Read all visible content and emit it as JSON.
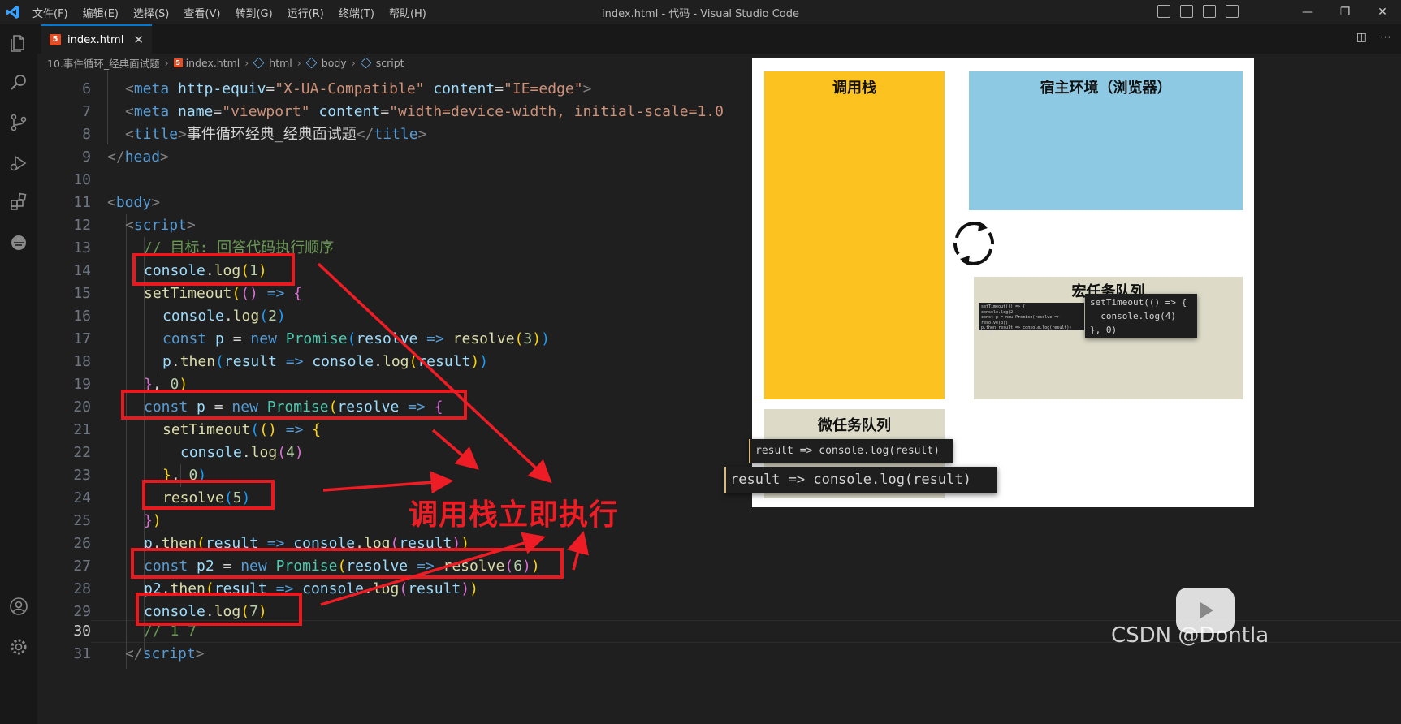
{
  "titlebar": {
    "menu": [
      "文件(F)",
      "编辑(E)",
      "选择(S)",
      "查看(V)",
      "转到(G)",
      "运行(R)",
      "终端(T)",
      "帮助(H)"
    ],
    "window_title": "index.html - 代码 - Visual Studio Code"
  },
  "tab": {
    "name": "index.html",
    "icon": "html5-icon",
    "close": "✕"
  },
  "breadcrumb": {
    "folder": "10.事件循环_经典面试题",
    "file": "index.html",
    "path": [
      "html",
      "body",
      "script"
    ]
  },
  "editor": {
    "line_numbers": [
      "6",
      "7",
      "8",
      "9",
      "10",
      "11",
      "12",
      "13",
      "14",
      "15",
      "16",
      "17",
      "18",
      "19",
      "20",
      "21",
      "22",
      "23",
      "24",
      "25",
      "26",
      "27",
      "28",
      "29",
      "30",
      "31"
    ],
    "current_line": "30",
    "code": {
      "l6_a": "<",
      "l6_b": "meta",
      "l6_c": " http-equiv",
      "l6_d": "=",
      "l6_e": "\"X-UA-Compatible\"",
      "l6_f": " content",
      "l6_g": "=",
      "l6_h": "\"IE=edge\"",
      "l6_i": ">",
      "l7_a": "<",
      "l7_b": "meta",
      "l7_c": " name",
      "l7_d": "=",
      "l7_e": "\"viewport\"",
      "l7_f": " content",
      "l7_g": "=",
      "l7_h": "\"width=device-width, initial-scale=1.0",
      "l8_a": "<",
      "l8_b": "title",
      "l8_c": ">",
      "l8_d": "事件循环经典_经典面试题",
      "l8_e": "</",
      "l8_f": "title",
      "l8_g": ">",
      "l9_a": "</",
      "l9_b": "head",
      "l9_c": ">",
      "l11_a": "<",
      "l11_b": "body",
      "l11_c": ">",
      "l12_a": "<",
      "l12_b": "script",
      "l12_c": ">",
      "l13": "// 目标: 回答代码执行顺序",
      "l14_a": "console",
      "l14_b": ".",
      "l14_c": "log",
      "l14_d": "(",
      "l14_e": "1",
      "l14_f": ")",
      "l15_a": "setTimeout",
      "l15_b": "(",
      "l15_c": "()",
      "l15_d": " => ",
      "l15_e": "{",
      "l16_a": "console",
      "l16_b": ".",
      "l16_c": "log",
      "l16_d": "(",
      "l16_e": "2",
      "l16_f": ")",
      "l17_a": "const",
      "l17_b": " p",
      "l17_c": " = ",
      "l17_d": "new",
      "l17_e": " Promise",
      "l17_f": "(",
      "l17_g": "resolve",
      "l17_h": " => ",
      "l17_i": "resolve",
      "l17_j": "(",
      "l17_k": "3",
      "l17_l": ")",
      "l17_m": ")",
      "l18_a": "p",
      "l18_b": ".",
      "l18_c": "then",
      "l18_d": "(",
      "l18_e": "result",
      "l18_f": " => ",
      "l18_g": "console",
      "l18_h": ".",
      "l18_i": "log",
      "l18_j": "(",
      "l18_k": "result",
      "l18_l": ")",
      "l18_m": ")",
      "l19_a": "}",
      "l19_b": ", ",
      "l19_c": "0",
      "l19_d": ")",
      "l20_a": "const",
      "l20_b": " p",
      "l20_c": " = ",
      "l20_d": "new",
      "l20_e": " Promise",
      "l20_f": "(",
      "l20_g": "resolve",
      "l20_h": " => ",
      "l20_i": "{",
      "l21_a": "setTimeout",
      "l21_b": "(",
      "l21_c": "()",
      "l21_d": " => ",
      "l21_e": "{",
      "l22_a": "console",
      "l22_b": ".",
      "l22_c": "log",
      "l22_d": "(",
      "l22_e": "4",
      "l22_f": ")",
      "l23_a": "}",
      "l23_b": ", ",
      "l23_c": "0",
      "l23_d": ")",
      "l24_a": "resolve",
      "l24_b": "(",
      "l24_c": "5",
      "l24_d": ")",
      "l25_a": "}",
      "l25_b": ")",
      "l26_a": "p",
      "l26_b": ".",
      "l26_c": "then",
      "l26_d": "(",
      "l26_e": "result",
      "l26_f": " => ",
      "l26_g": "console",
      "l26_h": ".",
      "l26_i": "log",
      "l26_j": "(",
      "l26_k": "result",
      "l26_l": ")",
      "l26_m": ")",
      "l27_a": "const",
      "l27_b": " p2",
      "l27_c": " = ",
      "l27_d": "new",
      "l27_e": " Promise",
      "l27_f": "(",
      "l27_g": "resolve",
      "l27_h": " => ",
      "l27_i": "resolve",
      "l27_j": "(",
      "l27_k": "6",
      "l27_l": ")",
      "l27_m": ")",
      "l28_a": "p2",
      "l28_b": ".",
      "l28_c": "then",
      "l28_d": "(",
      "l28_e": "result",
      "l28_f": " => ",
      "l28_g": "console",
      "l28_h": ".",
      "l28_i": "log",
      "l28_j": "(",
      "l28_k": "result",
      "l28_l": ")",
      "l28_m": ")",
      "l29_a": "console",
      "l29_b": ".",
      "l29_c": "log",
      "l29_d": "(",
      "l29_e": "7",
      "l29_f": ")",
      "l30": "// 1 7",
      "l31_a": "</",
      "l31_b": "script",
      "l31_c": ">"
    }
  },
  "diagram": {
    "call_stack_title": "调用栈",
    "host_title": "宿主环境（浏览器）",
    "macro_title": "宏任务队列",
    "micro_title": "微任务队列",
    "macro_snippet_lines": [
      "setTimeout(() => {",
      "  console.log(4)",
      "}, 0)"
    ],
    "macro_small_lines": [
      "setTimeout(() => {",
      "  console.log(2)",
      "  const p = new Promise(resolve => resolve(3))",
      "  p.then(result => console.log(result))",
      "}, 0)"
    ],
    "micro_items": [
      "result => console.log(result)",
      "result => console.log(result)"
    ]
  },
  "annotation": {
    "label": "调用栈立即执行",
    "color": "#ee1c24"
  },
  "watermark": {
    "text": "CSDN @Dontla"
  }
}
